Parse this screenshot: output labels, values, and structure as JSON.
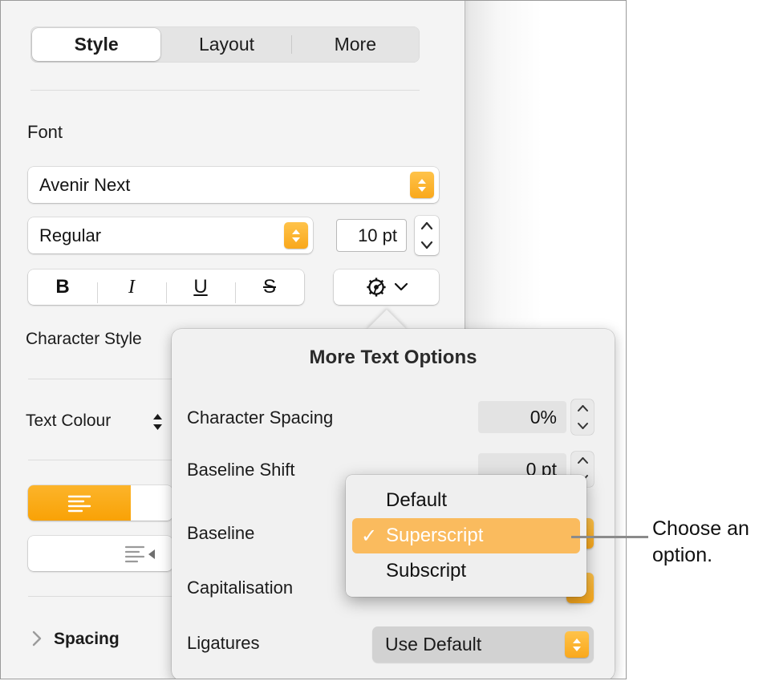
{
  "tabs": {
    "items": [
      {
        "label": "Style",
        "active": true
      },
      {
        "label": "Layout",
        "active": false
      },
      {
        "label": "More",
        "active": false
      }
    ]
  },
  "font_section": {
    "heading": "Font",
    "family_value": "Avenir Next",
    "weight_value": "Regular",
    "size_value": "10 pt",
    "styles": [
      "B",
      "I",
      "U",
      "S"
    ],
    "gear_icon": "gear-icon",
    "gear_chevron": "chevron-down-icon"
  },
  "character_style": {
    "label": "Character Style"
  },
  "text_colour": {
    "label": "Text Colour",
    "stepper_icon": "up-down-chevron-icon"
  },
  "alignment": {
    "selected_icon": "align-left-icon",
    "second_row_icon": "indent-right-icon"
  },
  "spacing": {
    "label": "Spacing",
    "disclosure_icon": "chevron-right-icon"
  },
  "popover": {
    "title": "More Text Options",
    "rows": [
      {
        "label": "Character Spacing",
        "value": "0%",
        "control": "stepper-field"
      },
      {
        "label": "Baseline Shift",
        "value": "0 pt",
        "control": "stepper-field"
      },
      {
        "label": "Baseline",
        "value": "",
        "control": "popup-button"
      },
      {
        "label": "Capitalisation",
        "value": "",
        "control": "popup-button"
      },
      {
        "label": "Ligatures",
        "value": "Use Default",
        "control": "popup-button"
      }
    ]
  },
  "dropdown": {
    "items": [
      {
        "label": "Default",
        "selected": false
      },
      {
        "label": "Superscript",
        "selected": true
      },
      {
        "label": "Subscript",
        "selected": false
      }
    ],
    "check_icon": "checkmark-icon",
    "highlight_color": "#fabb5e"
  },
  "callout": {
    "text": "Choose an option.",
    "line_color": "#8b8b8b"
  },
  "colors": {
    "accent_orange": "#f9a81c",
    "panel_background": "#f4f4f4",
    "popover_background": "#f1f1f1"
  }
}
